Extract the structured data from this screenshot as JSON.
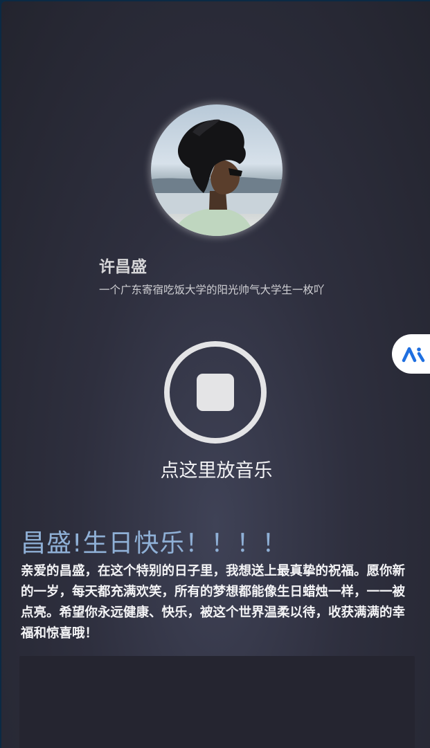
{
  "profile": {
    "name": "许昌盛",
    "bio": "一个广东寄宿吃饭大学的阳光帅气大学生一枚吖"
  },
  "music": {
    "state": "stop-icon",
    "label": "点这里放音乐"
  },
  "greeting": {
    "title": "昌盛!生日快乐！！！！",
    "body": "亲爱的昌盛，在这个特别的日子里，我想送上最真挚的祝福。愿你新的一岁，每天都充满欢笑，所有的梦想都能像生日蜡烛一样，一一被点亮。希望你永远健康、快乐，被这个世界温柔以待，收获满满的幸福和惊喜哦！"
  },
  "floating_assistant": {
    "icon": "ai-assistant-icon",
    "accent": "#1f6fe0"
  },
  "colors": {
    "title": "#8fb0d6",
    "background": "#2e2f3e"
  }
}
